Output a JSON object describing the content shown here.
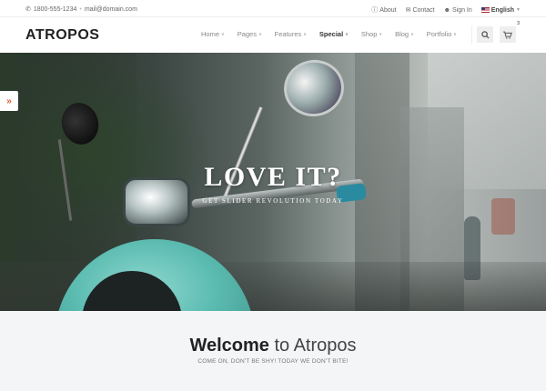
{
  "topbar": {
    "phone": "1800-555-1234",
    "separator": "•",
    "email": "mail@domain.com",
    "about": "About",
    "contact": "Contact",
    "signin": "Sign In",
    "language": "English"
  },
  "header": {
    "logo": "ATROPOS",
    "nav": [
      {
        "label": "Home"
      },
      {
        "label": "Pages"
      },
      {
        "label": "Features"
      },
      {
        "label": "Special"
      },
      {
        "label": "Shop"
      },
      {
        "label": "Blog"
      },
      {
        "label": "Portfolio"
      }
    ],
    "cart_count": "3",
    "icons": {
      "search": "search-icon",
      "cart": "cart-icon"
    }
  },
  "hero": {
    "title": "LOVE IT?",
    "subtitle": "GET SLIDER REVOLUTION TODAY",
    "arrow": "»"
  },
  "welcome": {
    "title_bold": "Welcome",
    "title_rest": " to Atropos",
    "subtitle": "COME ON, DON'T BE SHY! TODAY WE DON'T BITE!"
  },
  "colors": {
    "accent": "#e4572e",
    "scooter": "#5cbcb1",
    "welcome_bg": "#f4f5f7"
  }
}
